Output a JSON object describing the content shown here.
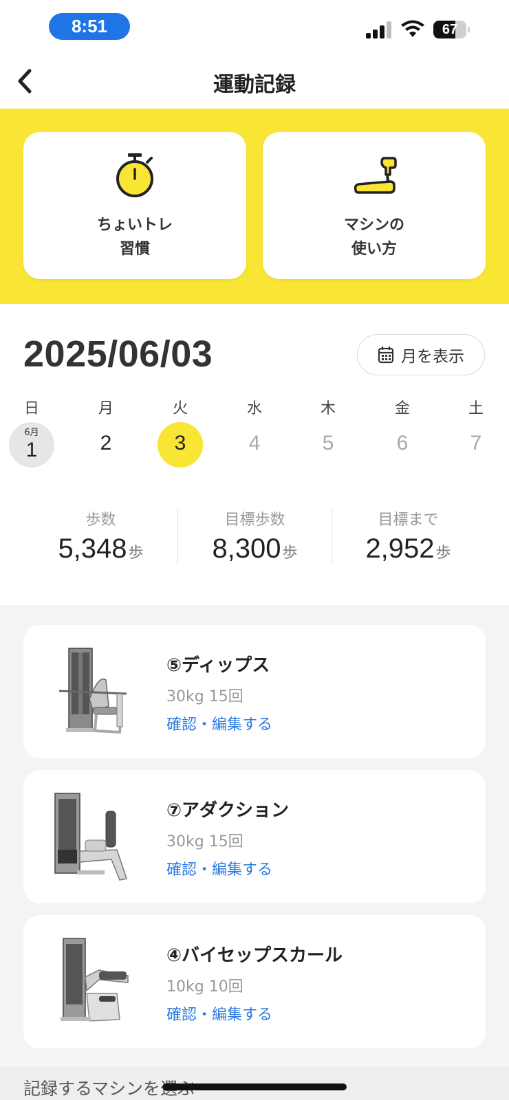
{
  "status_bar": {
    "time": "8:51",
    "battery": "67",
    "battery_level": 0.67
  },
  "nav": {
    "title": "運動記録"
  },
  "features": [
    {
      "label": "ちょいトレ\n習慣",
      "icon": "stopwatch-icon"
    },
    {
      "label": "マシンの\n使い方",
      "icon": "treadmill-icon"
    }
  ],
  "date": {
    "title": "2025/06/03",
    "month_button": "月を表示"
  },
  "week": {
    "weekdays": [
      "日",
      "月",
      "火",
      "水",
      "木",
      "金",
      "土"
    ],
    "days": [
      {
        "num": "1",
        "month": "6月",
        "state": "today-gray"
      },
      {
        "num": "2",
        "state": "normal"
      },
      {
        "num": "3",
        "state": "selected"
      },
      {
        "num": "4",
        "state": "future"
      },
      {
        "num": "5",
        "state": "future"
      },
      {
        "num": "6",
        "state": "future"
      },
      {
        "num": "7",
        "state": "future"
      }
    ]
  },
  "steps": {
    "unit": "歩",
    "items": [
      {
        "label": "歩数",
        "value": "5,348"
      },
      {
        "label": "目標歩数",
        "value": "8,300"
      },
      {
        "label": "目標まで",
        "value": "2,952"
      }
    ]
  },
  "records": [
    {
      "name": "⑤ディップス",
      "detail": "30kg 15回",
      "link": "確認・編集する",
      "machine": "dips"
    },
    {
      "name": "⑦アダクション",
      "detail": "30kg 15回",
      "link": "確認・編集する",
      "machine": "adduction"
    },
    {
      "name": "④バイセップスカール",
      "detail": "10kg 10回",
      "link": "確認・編集する",
      "machine": "biceps"
    }
  ],
  "select_machine": "記録するマシンを選ぶ",
  "colors": {
    "accent_yellow": "#f9e534",
    "link_blue": "#2a7ae2",
    "time_pill": "#1f74e6"
  }
}
